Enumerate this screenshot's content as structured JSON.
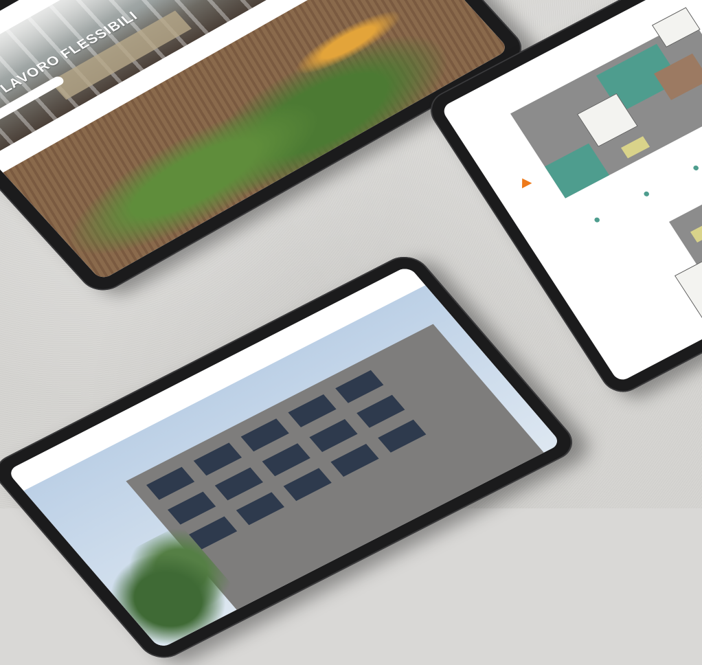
{
  "scene": {
    "description_hidden": "",
    "background_color": "#d6d5d2",
    "accent_orange": "#ee7a1b",
    "teal_room": "#4e9d8e"
  },
  "tablet_office": {
    "nav_items": [
      "",
      "",
      "",
      ""
    ],
    "hero_title": "…I DI LAVORO FLESSIBILI",
    "hero_button": ""
  },
  "tablet_plans": {
    "legend": [
      "",
      "",
      "",
      "",
      ""
    ]
  },
  "tablet_building": {
    "brand": "",
    "nav_items": [
      "",
      "",
      "",
      "",
      ""
    ]
  }
}
